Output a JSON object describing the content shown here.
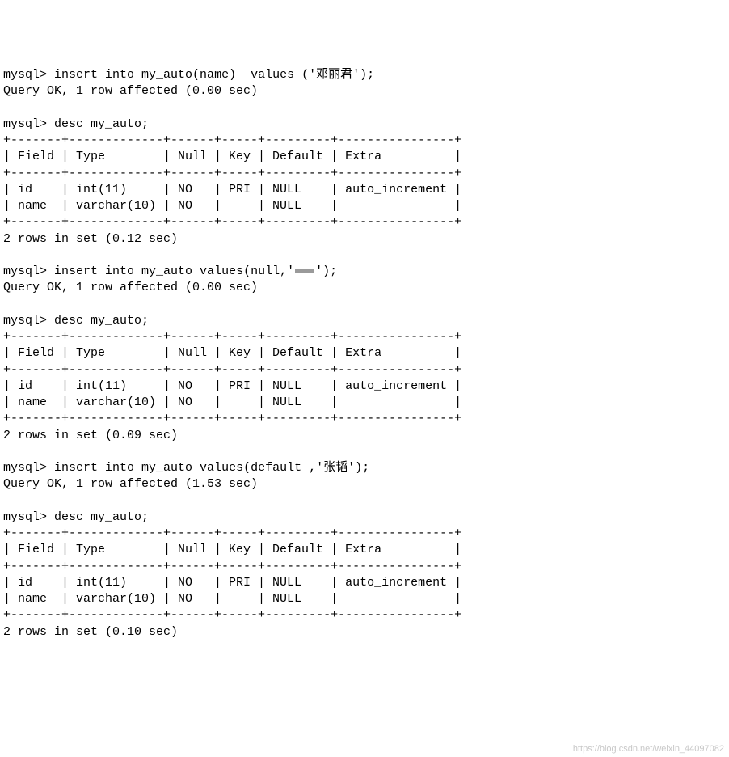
{
  "prompt": "mysql>",
  "commands": {
    "insert1": "insert into my_auto(name)  values ('邓丽君');",
    "insert2_prefix": "insert into my_auto values(null,'",
    "insert2_suffix": "');",
    "insert3": "insert into my_auto values(default ,'张韬');",
    "desc": "desc my_auto;"
  },
  "responses": {
    "ok_000": "Query OK, 1 row affected (0.00 sec)",
    "ok_153": "Query OK, 1 row affected (1.53 sec)",
    "set_012": "2 rows in set (0.12 sec)",
    "set_009": "2 rows in set (0.09 sec)",
    "set_010": "2 rows in set (0.10 sec)"
  },
  "table": {
    "border": "+-------+-------------+------+-----+---------+----------------+",
    "header": "| Field | Type        | Null | Key | Default | Extra          |",
    "row_id": "| id    | int(11)     | NO   | PRI | NULL    | auto_increment |",
    "row_name": "| name  | varchar(10) | NO   |     | NULL    |                |"
  },
  "watermark": "https://blog.csdn.net/weixin_44097082"
}
